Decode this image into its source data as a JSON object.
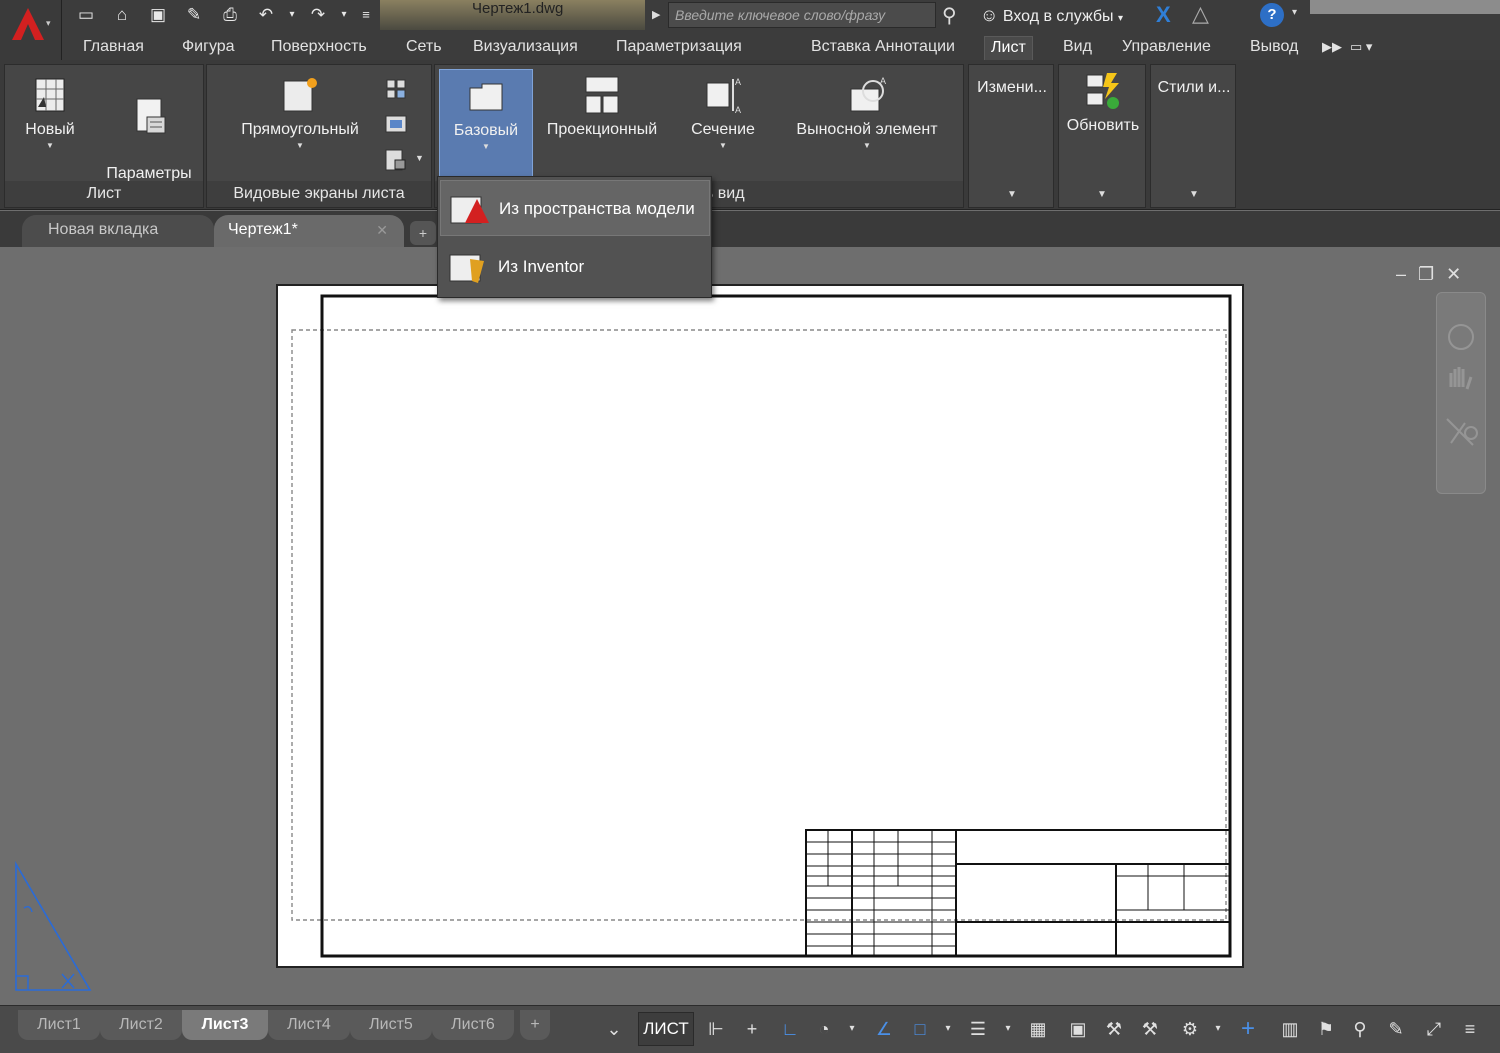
{
  "app": {
    "logo_letter": "A",
    "document_title": "Чертеж1.dwg"
  },
  "search": {
    "placeholder": "Введите ключевое слово/фразу"
  },
  "signin": {
    "label": "Вход в службы"
  },
  "help": {
    "label": "?"
  },
  "ribbon_tabs": [
    "Главная",
    "Фигура",
    "Поверхность",
    "Сеть",
    "Визуализация",
    "Параметризация",
    "Вставка",
    "Аннотации",
    "Лист",
    "Вид",
    "Управление",
    "Вывод"
  ],
  "ribbon_active_tab": "Лист",
  "panels": {
    "sheet": {
      "title": "Лист",
      "new_label": "Новый",
      "page_params_label": "Параметры\nстраницы"
    },
    "viewports": {
      "title": "Видовые экраны листа",
      "rect_label": "Прямоугольный"
    },
    "create_view": {
      "title_visible": "ь вид",
      "base_label": "Базовый",
      "projected_label": "Проекционный",
      "section_label": "Сечение",
      "detail_label": "Выносной элемент"
    },
    "modify": {
      "label": "Измени..."
    },
    "update": {
      "label": "Обновить"
    },
    "styles": {
      "label": "Стили и..."
    }
  },
  "dropdown": {
    "items": [
      "Из пространства модели",
      "Из Inventor"
    ]
  },
  "doc_tabs": {
    "new_tab": "Новая вкладка",
    "drawing_tab": "Чертеж1*",
    "add": "+"
  },
  "layout_tabs": [
    "Лист1",
    "Лист2",
    "Лист3",
    "Лист4",
    "Лист5",
    "Лист6"
  ],
  "active_layout": "Лист3",
  "status": {
    "space_label": "ЛИСТ"
  },
  "colors": {
    "accent": "#2d6fc6",
    "logo": "#d32020",
    "ucs": "#2a6bd8"
  }
}
